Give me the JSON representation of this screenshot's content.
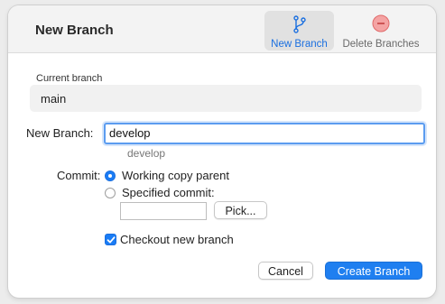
{
  "header": {
    "title": "New Branch",
    "tabs": [
      {
        "label": "New Branch",
        "icon": "branch-icon",
        "active": true
      },
      {
        "label": "Delete Branches",
        "icon": "delete-circle-icon",
        "active": false
      }
    ]
  },
  "current_branch": {
    "label": "Current branch",
    "value": "main"
  },
  "new_branch": {
    "label": "New Branch:",
    "value": "develop",
    "hint": "develop"
  },
  "commit": {
    "label": "Commit:",
    "options": [
      {
        "label": "Working copy parent",
        "selected": true
      },
      {
        "label": "Specified commit:",
        "selected": false
      }
    ],
    "specified_value": "",
    "pick_label": "Pick..."
  },
  "checkout": {
    "label": "Checkout new branch",
    "checked": true
  },
  "buttons": {
    "cancel": "Cancel",
    "create": "Create Branch"
  },
  "colors": {
    "accent": "#1f7ff0",
    "delete_icon": "#f07a7a"
  }
}
